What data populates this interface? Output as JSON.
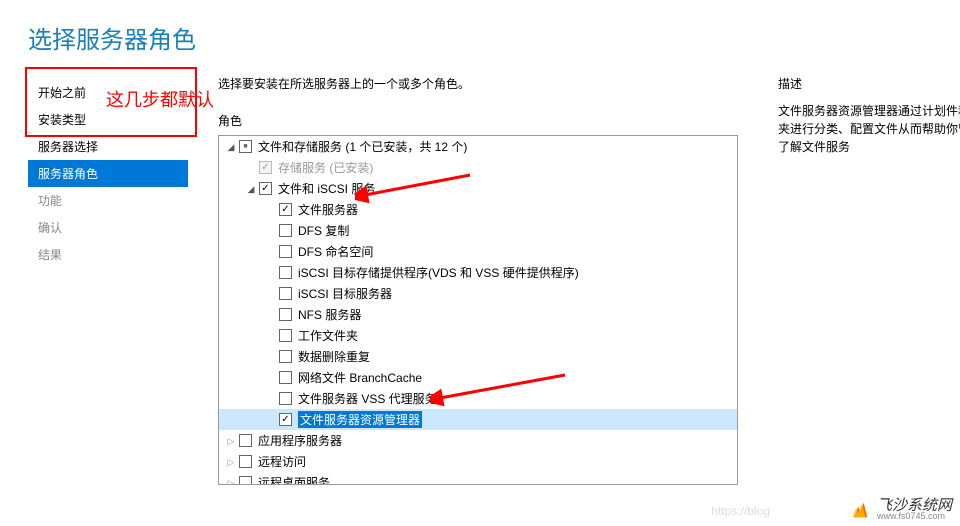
{
  "title": "选择服务器角色",
  "instruction": "选择要安装在所选服务器上的一个或多个角色。",
  "sidebar": {
    "items": [
      {
        "label": "开始之前",
        "state": "completed"
      },
      {
        "label": "安装类型",
        "state": "completed"
      },
      {
        "label": "服务器选择",
        "state": "completed"
      },
      {
        "label": "服务器角色",
        "state": "active"
      },
      {
        "label": "功能",
        "state": "future"
      },
      {
        "label": "确认",
        "state": "future"
      },
      {
        "label": "结果",
        "state": "future"
      }
    ]
  },
  "annotation": {
    "text": "这几步都默认"
  },
  "roles": {
    "heading": "角色",
    "tree": [
      {
        "indent": 0,
        "caret": "expanded",
        "chk": "mixed",
        "label": "文件和存储服务 (1 个已安装，共 12 个)",
        "disabled": false
      },
      {
        "indent": 1,
        "caret": "none",
        "chk": "checked",
        "label": "存储服务 (已安装)",
        "disabled": true
      },
      {
        "indent": 1,
        "caret": "expanded",
        "chk": "checked",
        "label": "文件和 iSCSI 服务",
        "disabled": false
      },
      {
        "indent": 2,
        "caret": "none",
        "chk": "checked",
        "label": "文件服务器",
        "disabled": false,
        "arrow1": true
      },
      {
        "indent": 2,
        "caret": "none",
        "chk": "empty",
        "label": "DFS 复制",
        "disabled": false
      },
      {
        "indent": 2,
        "caret": "none",
        "chk": "empty",
        "label": "DFS 命名空间",
        "disabled": false
      },
      {
        "indent": 2,
        "caret": "none",
        "chk": "empty",
        "label": "iSCSI 目标存储提供程序(VDS 和 VSS 硬件提供程序)",
        "disabled": false
      },
      {
        "indent": 2,
        "caret": "none",
        "chk": "empty",
        "label": "iSCSI 目标服务器",
        "disabled": false
      },
      {
        "indent": 2,
        "caret": "none",
        "chk": "empty",
        "label": "NFS 服务器",
        "disabled": false
      },
      {
        "indent": 2,
        "caret": "none",
        "chk": "empty",
        "label": "工作文件夹",
        "disabled": false
      },
      {
        "indent": 2,
        "caret": "none",
        "chk": "empty",
        "label": "数据删除重复",
        "disabled": false
      },
      {
        "indent": 2,
        "caret": "none",
        "chk": "empty",
        "label": "网络文件 BranchCache",
        "disabled": false
      },
      {
        "indent": 2,
        "caret": "none",
        "chk": "empty",
        "label": "文件服务器 VSS 代理服务",
        "disabled": false
      },
      {
        "indent": 2,
        "caret": "none",
        "chk": "checked",
        "label": "文件服务器资源管理器",
        "disabled": false,
        "selected": true,
        "arrow2": true
      },
      {
        "indent": 0,
        "caret": "collapsed",
        "chk": "empty",
        "label": "应用程序服务器",
        "disabled": false
      },
      {
        "indent": 0,
        "caret": "collapsed",
        "chk": "empty",
        "label": "远程访问",
        "disabled": false
      },
      {
        "indent": 0,
        "caret": "collapsed",
        "chk": "empty",
        "label": "远程桌面服务",
        "disabled": false,
        "cut": true
      }
    ]
  },
  "description": {
    "heading": "描述",
    "text": "文件服务器资源管理器通过计划件和文件夹进行分类、配置文件从而帮助你管理和了解文件服务"
  },
  "watermark": {
    "cn": "飞沙系统网",
    "url": "www.fs0745.com"
  },
  "blog_wm": "https://blog"
}
